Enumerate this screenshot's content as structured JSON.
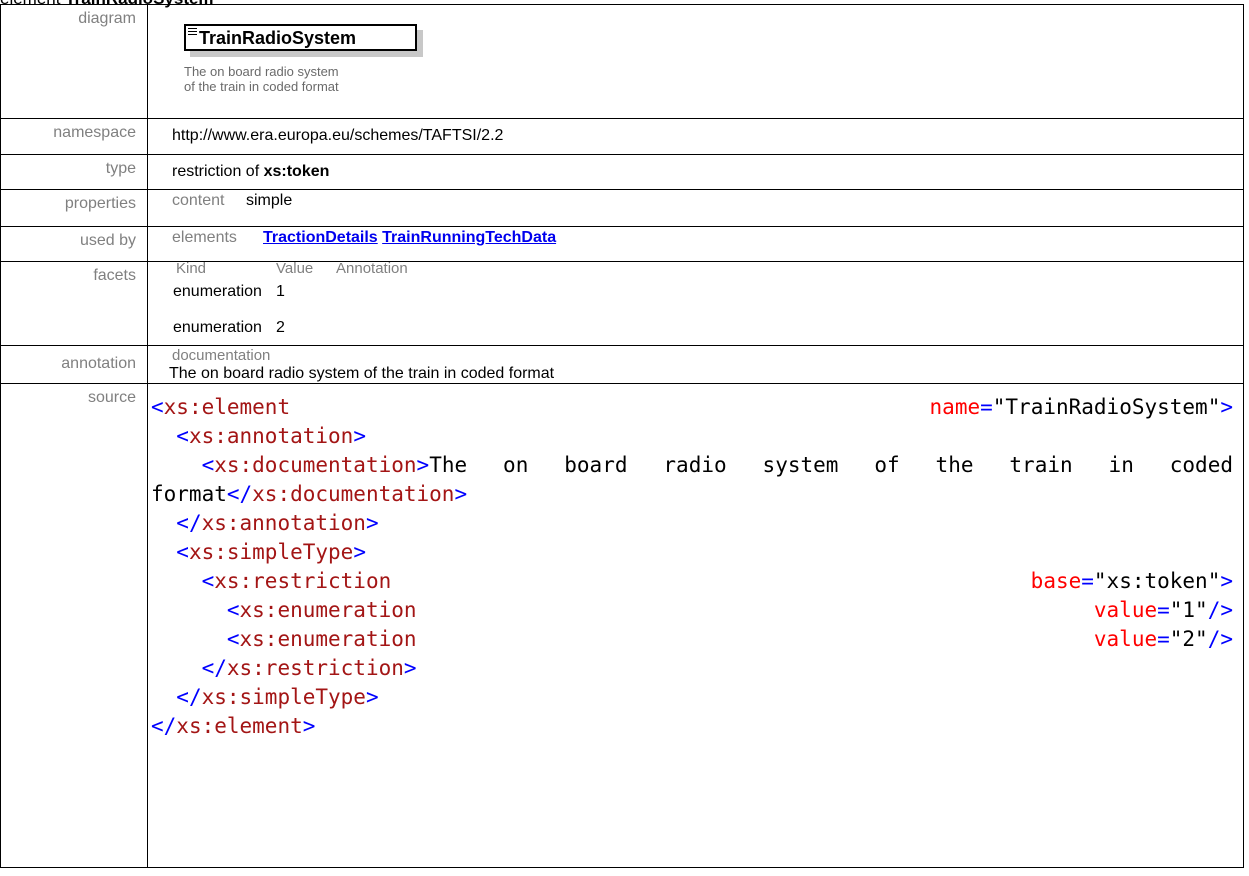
{
  "page": {
    "heading_prefix": "element",
    "heading_name": "TrainRadioSystem"
  },
  "labels": {
    "diagram": "diagram",
    "namespace": "namespace",
    "type": "type",
    "properties": "properties",
    "used_by": "used by",
    "facets": "facets",
    "annotation": "annotation",
    "source": "source"
  },
  "diagram": {
    "element_name": "TrainRadioSystem",
    "caption_line1": "The on board radio system",
    "caption_line2": "of the train in coded format"
  },
  "namespace": {
    "value": "http://www.era.europa.eu/schemes/TAFTSI/2.2"
  },
  "type": {
    "prefix": "restriction of ",
    "base": "xs:token"
  },
  "properties": {
    "key": "content",
    "value": "simple"
  },
  "used_by": {
    "kind": "elements",
    "links": [
      "TractionDetails",
      "TrainRunningTechData"
    ]
  },
  "facets": {
    "headers": [
      "Kind",
      "Value",
      "Annotation"
    ],
    "rows": [
      {
        "kind": "enumeration",
        "value": "1"
      },
      {
        "kind": "enumeration",
        "value": "2"
      }
    ]
  },
  "annotation": {
    "key": "documentation",
    "text": "The on board radio system of the train in coded format"
  },
  "source": {
    "lines": [
      [
        "<",
        "xs:element",
        "",
        "name",
        "=\"",
        "TrainRadioSystem",
        "\">"
      ],
      [
        "  <",
        "xs:annotation",
        ">"
      ],
      [
        "    <",
        "xs:documentation",
        ">",
        "The on board radio system of the train in coded",
        ""
      ],
      [
        "format",
        "</",
        "xs:documentation",
        ">"
      ],
      [
        "  </",
        "xs:annotation",
        ">"
      ],
      [
        "  <",
        "xs:simpleType",
        ">"
      ],
      [
        "    <",
        "xs:restriction",
        "base",
        "xs:token"
      ],
      [
        "      <",
        "xs:enumeration",
        "value",
        "1"
      ],
      [
        "      <",
        "xs:enumeration",
        "value",
        "2"
      ],
      [
        "    </",
        "xs:restriction",
        ">"
      ],
      [
        "  </",
        "xs:simpleType",
        ">"
      ],
      [
        "</",
        "xs:element",
        ">"
      ]
    ]
  },
  "colors": {
    "tag": "#a31515",
    "bracket": "#0000ff",
    "attribute": "#ff0000",
    "link": "#0000ee",
    "label": "#808080"
  }
}
